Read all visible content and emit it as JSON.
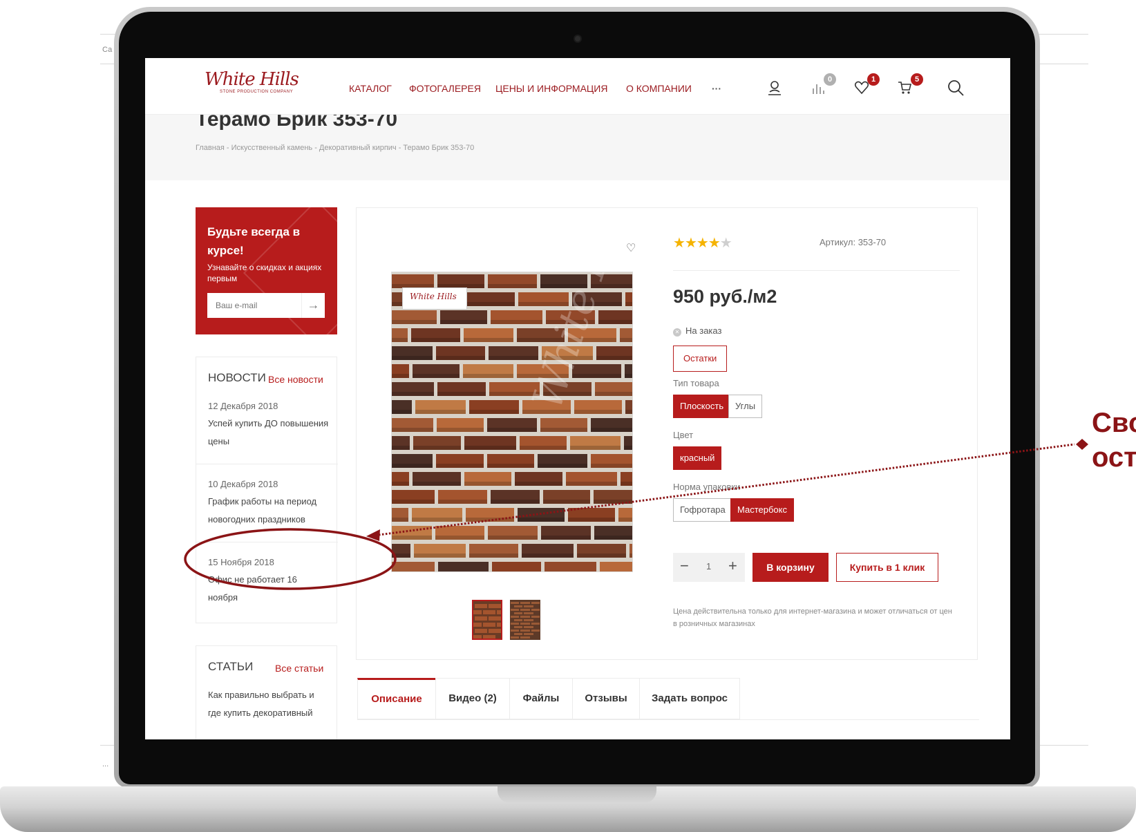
{
  "background_page": {
    "left_fragment": "Са",
    "bottom_fragment": "..."
  },
  "header": {
    "logo_text": "White Hills",
    "logo_subtitle": "STONE PRODUCTION COMPANY",
    "nav": [
      "КАТАЛОГ",
      "ФОТОГАЛЕРЕЯ",
      "ЦЕНЫ И ИНФОРМАЦИЯ",
      "О КОМПАНИИ",
      "···"
    ],
    "compare_count": "0",
    "wishlist_count": "1",
    "cart_count": "5"
  },
  "page": {
    "title": "Терамо Брик 353-70",
    "breadcrumb": "Главная - Искусственный камень - Декоративный кирпич - Терамо Брик 353-70"
  },
  "subscribe": {
    "title": "Будьте всегда в курсе!",
    "description": "Узнавайте о скидках и акциях первым",
    "placeholder": "Ваш e-mail",
    "arrow": "→"
  },
  "news": {
    "heading": "НОВОСТИ",
    "all_link": "Все новости",
    "items": [
      {
        "date": "12 Декабря 2018",
        "text": "Успей купить ДО повышения цены"
      },
      {
        "date": "10 Декабря 2018",
        "text": "График работы на период новогодних праздников"
      },
      {
        "date": "15 Ноября 2018",
        "text": "Офис не работает 16 ноября"
      }
    ]
  },
  "articles": {
    "heading": "СТАТЬИ",
    "all_link": "Все статьи",
    "items": [
      {
        "text": "Как правильно выбрать и где купить декоративный"
      }
    ]
  },
  "product": {
    "rating": 4,
    "rating_max": 5,
    "sku": "Артикул: 353-70",
    "price": "950 руб./м2",
    "availability": "На заказ",
    "stock_button": "Остатки",
    "type_label": "Тип товара",
    "type_options": [
      {
        "label": "Плоскость",
        "selected": true
      },
      {
        "label": "Углы",
        "selected": false
      }
    ],
    "color_label": "Цвет",
    "color_options": [
      {
        "label": "красный",
        "selected": true
      }
    ],
    "pack_label": "Норма упаковки",
    "pack_options": [
      {
        "label": "Гофротара",
        "selected": false
      },
      {
        "label": "Мастербокс",
        "selected": true
      }
    ],
    "quantity": "1",
    "minus": "−",
    "plus": "+",
    "to_cart": "В корзину",
    "buy_one_click": "Купить в 1 клик",
    "price_note": "Цена действительна только для интернет-магазина и может отличаться от цен в розничных магазинах",
    "image_watermark": "White Hills",
    "image_logo": "White Hills"
  },
  "tabs": [
    "Описание",
    "Видео  (2)",
    "Файлы",
    "Отзывы",
    "Задать вопрос"
  ],
  "annotation": {
    "line1": "Сво",
    "line2": "ост"
  },
  "colors": {
    "brand": "#b71c1c",
    "annotation": "#8b1416",
    "star": "#f5b301"
  }
}
